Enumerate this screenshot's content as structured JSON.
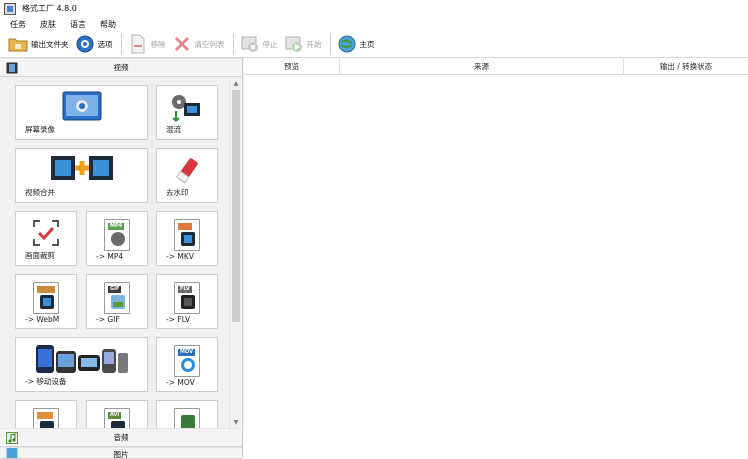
{
  "window": {
    "title": "格式工厂 4.8.0"
  },
  "menu": [
    "任务",
    "皮肤",
    "语言",
    "帮助"
  ],
  "toolbar": {
    "output_folder": "输出文件夹",
    "options": "选项",
    "remove": "移除",
    "clear_list": "清空列表",
    "stop": "停止",
    "start": "开始",
    "home": "主页"
  },
  "left_panel": {
    "video_header": "视频",
    "audio_header": "音频",
    "image_header_partial": "图片",
    "tiles": {
      "screen_record": "屏幕录像",
      "mix": "混流",
      "video_merge": "视频合并",
      "remove_watermark": "去水印",
      "crop": "画面裁剪",
      "to_mp4": "-> MP4",
      "to_mkv": "-> MKV",
      "to_webm": "-> WebM",
      "to_gif": "-> GIF",
      "to_flv": "-> FLV",
      "to_mobile": "-> 移动设备",
      "to_mov": "-> MOV"
    },
    "badges": {
      "mp4": "MP4",
      "gif": "GIF",
      "flv": "FLV",
      "mov": "MOV",
      "avi": "AVI"
    }
  },
  "task_list": {
    "columns": [
      "预览",
      "来源",
      "输出 / 转换状态"
    ]
  },
  "colors": {
    "accent_blue": "#2f6fc6",
    "mp4_green": "#5aa05a",
    "mkv_orange": "#e07a3a",
    "gif_dark": "#3a3a3a",
    "mov_blue": "#2a6fb8"
  }
}
